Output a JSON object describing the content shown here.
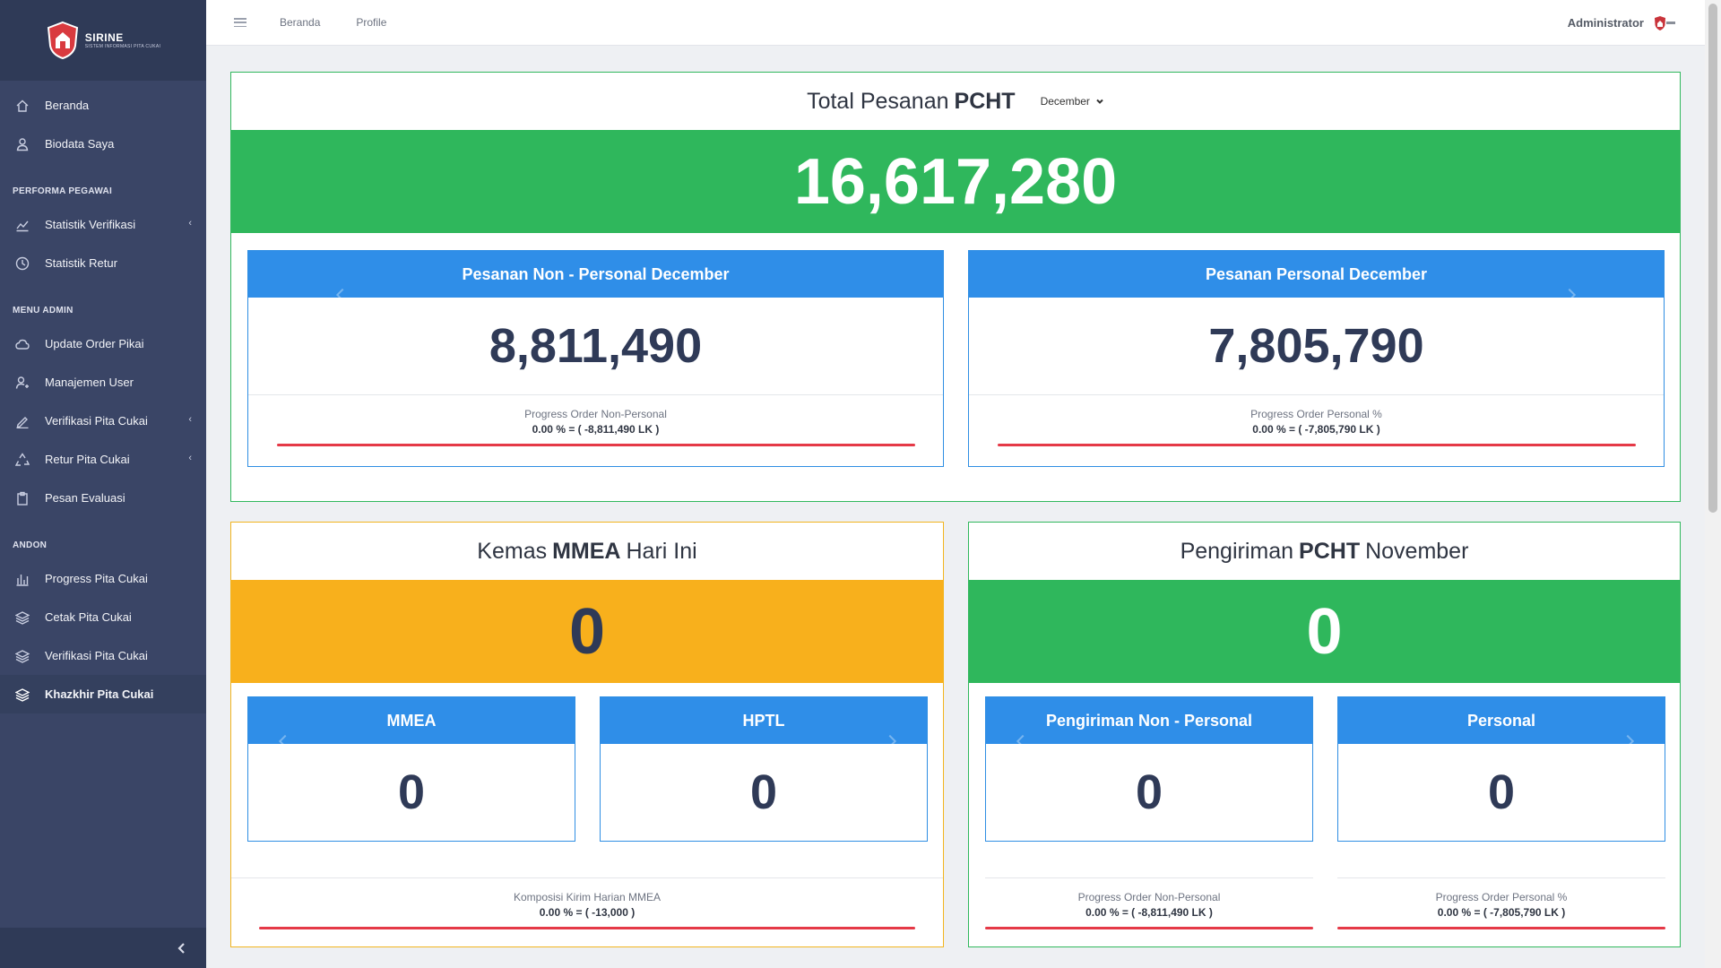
{
  "brand": {
    "name": "SIRINE",
    "tagline": "SISTEM INFORMASI PITA CUKAI"
  },
  "sidebar": {
    "items_top": [
      {
        "label": "Beranda",
        "icon": "home-icon"
      },
      {
        "label": "Biodata Saya",
        "icon": "user-icon"
      }
    ],
    "section_performa": "PERFORMA PEGAWAI",
    "items_performa": [
      {
        "label": "Statistik Verifikasi",
        "icon": "chart-line-icon",
        "has_children": true
      },
      {
        "label": "Statistik Retur",
        "icon": "clock-icon"
      }
    ],
    "section_admin": "MENU ADMIN",
    "items_admin": [
      {
        "label": "Update Order Pikai",
        "icon": "cloud-icon"
      },
      {
        "label": "Manajemen User",
        "icon": "user-settings-icon"
      },
      {
        "label": "Verifikasi Pita Cukai",
        "icon": "pen-icon",
        "has_children": true
      },
      {
        "label": "Retur Pita Cukai",
        "icon": "recycle-icon",
        "has_children": true
      },
      {
        "label": "Pesan Evaluasi",
        "icon": "clipboard-icon"
      }
    ],
    "section_andon": "ANDON",
    "items_andon": [
      {
        "label": "Progress Pita Cukai",
        "icon": "bar-chart-icon"
      },
      {
        "label": "Cetak Pita Cukai",
        "icon": "layers-icon"
      },
      {
        "label": "Verifikasi Pita Cukai",
        "icon": "layers-icon"
      },
      {
        "label": "Khazkhir Pita Cukai",
        "icon": "layers-icon",
        "active": true
      }
    ]
  },
  "topbar": {
    "links": [
      "Beranda",
      "Profile"
    ],
    "user": "Administrator"
  },
  "total_pesanan": {
    "title_prefix": "Total Pesanan",
    "title_bold": "PCHT",
    "month_selected": "December",
    "value": "16,617,280",
    "non_personal": {
      "title": "Pesanan Non - Personal December",
      "value": "8,811,490",
      "progress_label": "Progress Order Non-Personal",
      "progress_value": "0.00 % = ( -8,811,490 LK )"
    },
    "personal": {
      "title": "Pesanan Personal December",
      "value": "7,805,790",
      "progress_label": "Progress Order Personal %",
      "progress_value": "0.00 % = ( -7,805,790 LK )"
    }
  },
  "kemas": {
    "title_prefix": "Kemas",
    "title_bold": "MMEA",
    "title_suffix": "Hari Ini",
    "value": "0",
    "mmea": {
      "title": "MMEA",
      "value": "0"
    },
    "hptl": {
      "title": "HPTL",
      "value": "0"
    },
    "foot_label": "Komposisi Kirim Harian MMEA",
    "foot_value": "0.00 % = ( -13,000 )"
  },
  "pengiriman": {
    "title_prefix": "Pengiriman",
    "title_bold": "PCHT",
    "title_suffix": "November",
    "value": "0",
    "non_personal": {
      "title": "Pengiriman Non - Personal",
      "value": "0",
      "progress_label": "Progress Order Non-Personal",
      "progress_value": "0.00 % = ( -8,811,490 LK )"
    },
    "personal": {
      "title": "Personal",
      "value": "0",
      "progress_label": "Progress Order Personal %",
      "progress_value": "0.00 % = ( -7,805,790 LK )"
    }
  },
  "colors": {
    "sidebar": "#3a4566",
    "green": "#2fb75c",
    "yellow": "#f8b01c",
    "blue": "#2f8ee8",
    "red": "#e53947"
  }
}
